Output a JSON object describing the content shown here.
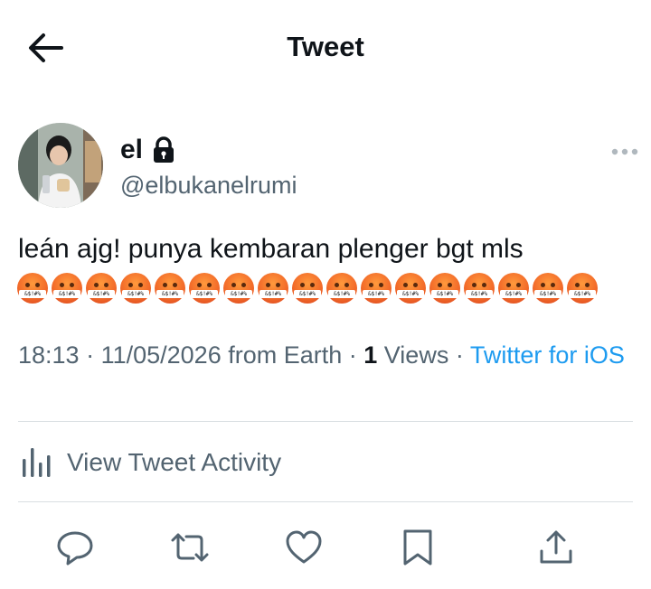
{
  "header": {
    "title": "Tweet"
  },
  "author": {
    "display_name": "el",
    "handle": "@elbukanelrumi"
  },
  "tweet": {
    "text": "leán ajg! punya kembaran plenger bgt mls",
    "emoji_symbol": "&$!#%",
    "emoji_count": 17
  },
  "meta": {
    "time": "18:13",
    "sep1": " · ",
    "date": "11/05/2026",
    "from": " from Earth · ",
    "views_count": "1",
    "views_label": " Views · ",
    "client": "Twitter for iOS"
  },
  "activity": {
    "label": "View Tweet Activity"
  },
  "colors": {
    "accent": "#1d9bf0",
    "text": "#0f1419",
    "muted": "#536471",
    "divider": "#d9dee2"
  },
  "icons": [
    "back-arrow-icon",
    "lock-icon",
    "more-icon",
    "analytics-icon",
    "reply-icon",
    "retweet-icon",
    "like-icon",
    "bookmark-icon",
    "share-icon"
  ]
}
